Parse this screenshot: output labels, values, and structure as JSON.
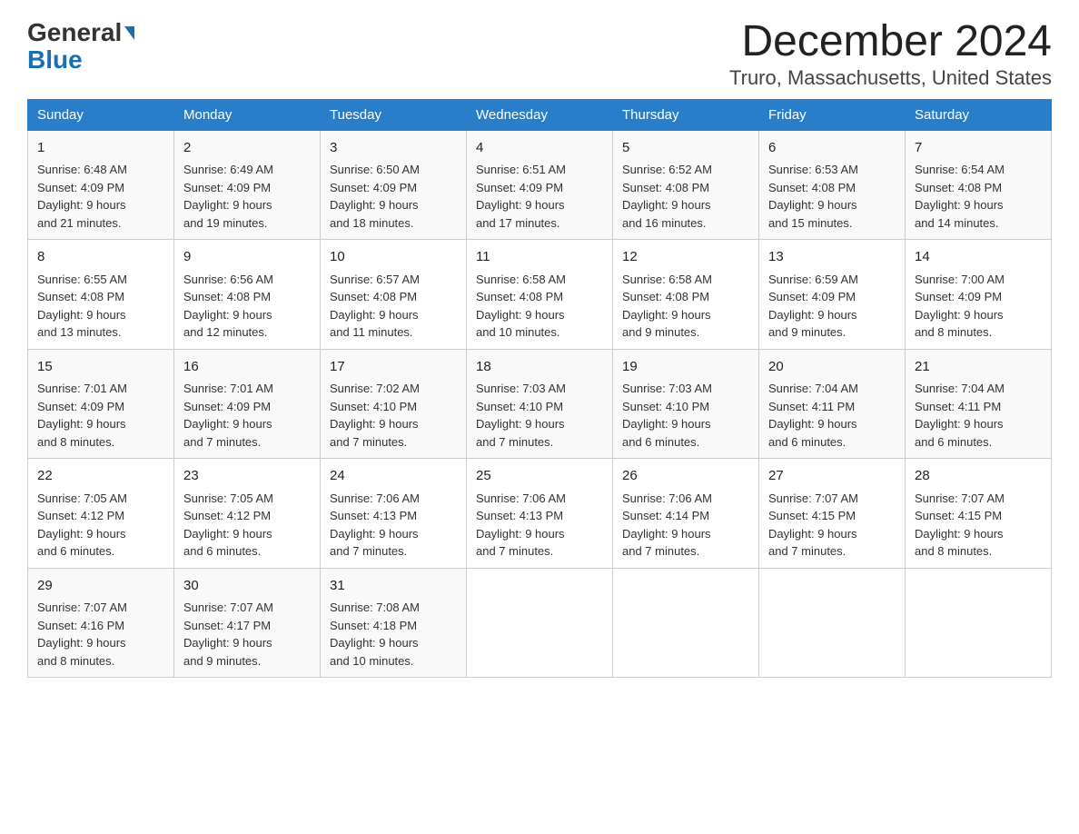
{
  "header": {
    "title": "December 2024",
    "subtitle": "Truro, Massachusetts, United States",
    "logo_general": "General",
    "logo_blue": "Blue"
  },
  "days_of_week": [
    "Sunday",
    "Monday",
    "Tuesday",
    "Wednesday",
    "Thursday",
    "Friday",
    "Saturday"
  ],
  "weeks": [
    [
      {
        "day": "1",
        "sunrise": "6:48 AM",
        "sunset": "4:09 PM",
        "daylight": "9 hours and 21 minutes."
      },
      {
        "day": "2",
        "sunrise": "6:49 AM",
        "sunset": "4:09 PM",
        "daylight": "9 hours and 19 minutes."
      },
      {
        "day": "3",
        "sunrise": "6:50 AM",
        "sunset": "4:09 PM",
        "daylight": "9 hours and 18 minutes."
      },
      {
        "day": "4",
        "sunrise": "6:51 AM",
        "sunset": "4:09 PM",
        "daylight": "9 hours and 17 minutes."
      },
      {
        "day": "5",
        "sunrise": "6:52 AM",
        "sunset": "4:08 PM",
        "daylight": "9 hours and 16 minutes."
      },
      {
        "day": "6",
        "sunrise": "6:53 AM",
        "sunset": "4:08 PM",
        "daylight": "9 hours and 15 minutes."
      },
      {
        "day": "7",
        "sunrise": "6:54 AM",
        "sunset": "4:08 PM",
        "daylight": "9 hours and 14 minutes."
      }
    ],
    [
      {
        "day": "8",
        "sunrise": "6:55 AM",
        "sunset": "4:08 PM",
        "daylight": "9 hours and 13 minutes."
      },
      {
        "day": "9",
        "sunrise": "6:56 AM",
        "sunset": "4:08 PM",
        "daylight": "9 hours and 12 minutes."
      },
      {
        "day": "10",
        "sunrise": "6:57 AM",
        "sunset": "4:08 PM",
        "daylight": "9 hours and 11 minutes."
      },
      {
        "day": "11",
        "sunrise": "6:58 AM",
        "sunset": "4:08 PM",
        "daylight": "9 hours and 10 minutes."
      },
      {
        "day": "12",
        "sunrise": "6:58 AM",
        "sunset": "4:08 PM",
        "daylight": "9 hours and 9 minutes."
      },
      {
        "day": "13",
        "sunrise": "6:59 AM",
        "sunset": "4:09 PM",
        "daylight": "9 hours and 9 minutes."
      },
      {
        "day": "14",
        "sunrise": "7:00 AM",
        "sunset": "4:09 PM",
        "daylight": "9 hours and 8 minutes."
      }
    ],
    [
      {
        "day": "15",
        "sunrise": "7:01 AM",
        "sunset": "4:09 PM",
        "daylight": "9 hours and 8 minutes."
      },
      {
        "day": "16",
        "sunrise": "7:01 AM",
        "sunset": "4:09 PM",
        "daylight": "9 hours and 7 minutes."
      },
      {
        "day": "17",
        "sunrise": "7:02 AM",
        "sunset": "4:10 PM",
        "daylight": "9 hours and 7 minutes."
      },
      {
        "day": "18",
        "sunrise": "7:03 AM",
        "sunset": "4:10 PM",
        "daylight": "9 hours and 7 minutes."
      },
      {
        "day": "19",
        "sunrise": "7:03 AM",
        "sunset": "4:10 PM",
        "daylight": "9 hours and 6 minutes."
      },
      {
        "day": "20",
        "sunrise": "7:04 AM",
        "sunset": "4:11 PM",
        "daylight": "9 hours and 6 minutes."
      },
      {
        "day": "21",
        "sunrise": "7:04 AM",
        "sunset": "4:11 PM",
        "daylight": "9 hours and 6 minutes."
      }
    ],
    [
      {
        "day": "22",
        "sunrise": "7:05 AM",
        "sunset": "4:12 PM",
        "daylight": "9 hours and 6 minutes."
      },
      {
        "day": "23",
        "sunrise": "7:05 AM",
        "sunset": "4:12 PM",
        "daylight": "9 hours and 6 minutes."
      },
      {
        "day": "24",
        "sunrise": "7:06 AM",
        "sunset": "4:13 PM",
        "daylight": "9 hours and 7 minutes."
      },
      {
        "day": "25",
        "sunrise": "7:06 AM",
        "sunset": "4:13 PM",
        "daylight": "9 hours and 7 minutes."
      },
      {
        "day": "26",
        "sunrise": "7:06 AM",
        "sunset": "4:14 PM",
        "daylight": "9 hours and 7 minutes."
      },
      {
        "day": "27",
        "sunrise": "7:07 AM",
        "sunset": "4:15 PM",
        "daylight": "9 hours and 7 minutes."
      },
      {
        "day": "28",
        "sunrise": "7:07 AM",
        "sunset": "4:15 PM",
        "daylight": "9 hours and 8 minutes."
      }
    ],
    [
      {
        "day": "29",
        "sunrise": "7:07 AM",
        "sunset": "4:16 PM",
        "daylight": "9 hours and 8 minutes."
      },
      {
        "day": "30",
        "sunrise": "7:07 AM",
        "sunset": "4:17 PM",
        "daylight": "9 hours and 9 minutes."
      },
      {
        "day": "31",
        "sunrise": "7:08 AM",
        "sunset": "4:18 PM",
        "daylight": "9 hours and 10 minutes."
      },
      null,
      null,
      null,
      null
    ]
  ]
}
